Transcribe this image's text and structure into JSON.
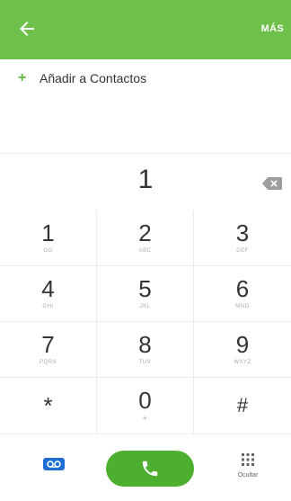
{
  "topbar": {
    "more_label": "MÁS"
  },
  "add_contact": {
    "label": "Añadir a Contactos"
  },
  "dialed_number": "1",
  "keypad": [
    {
      "digit": "1",
      "letters": "OO"
    },
    {
      "digit": "2",
      "letters": "ABC"
    },
    {
      "digit": "3",
      "letters": "DEF"
    },
    {
      "digit": "4",
      "letters": "GHI"
    },
    {
      "digit": "5",
      "letters": "JKL"
    },
    {
      "digit": "6",
      "letters": "MNO"
    },
    {
      "digit": "7",
      "letters": "PQRS"
    },
    {
      "digit": "8",
      "letters": "TUV"
    },
    {
      "digit": "9",
      "letters": "WXYZ"
    },
    {
      "digit": "*",
      "letters": ""
    },
    {
      "digit": "0",
      "letters": "+"
    },
    {
      "digit": "#",
      "letters": ""
    }
  ],
  "bottom": {
    "hide_label": "Ocultar"
  },
  "colors": {
    "accent": "#6ec04b",
    "call": "#4caf2f",
    "voicemail": "#1e6ed6"
  }
}
